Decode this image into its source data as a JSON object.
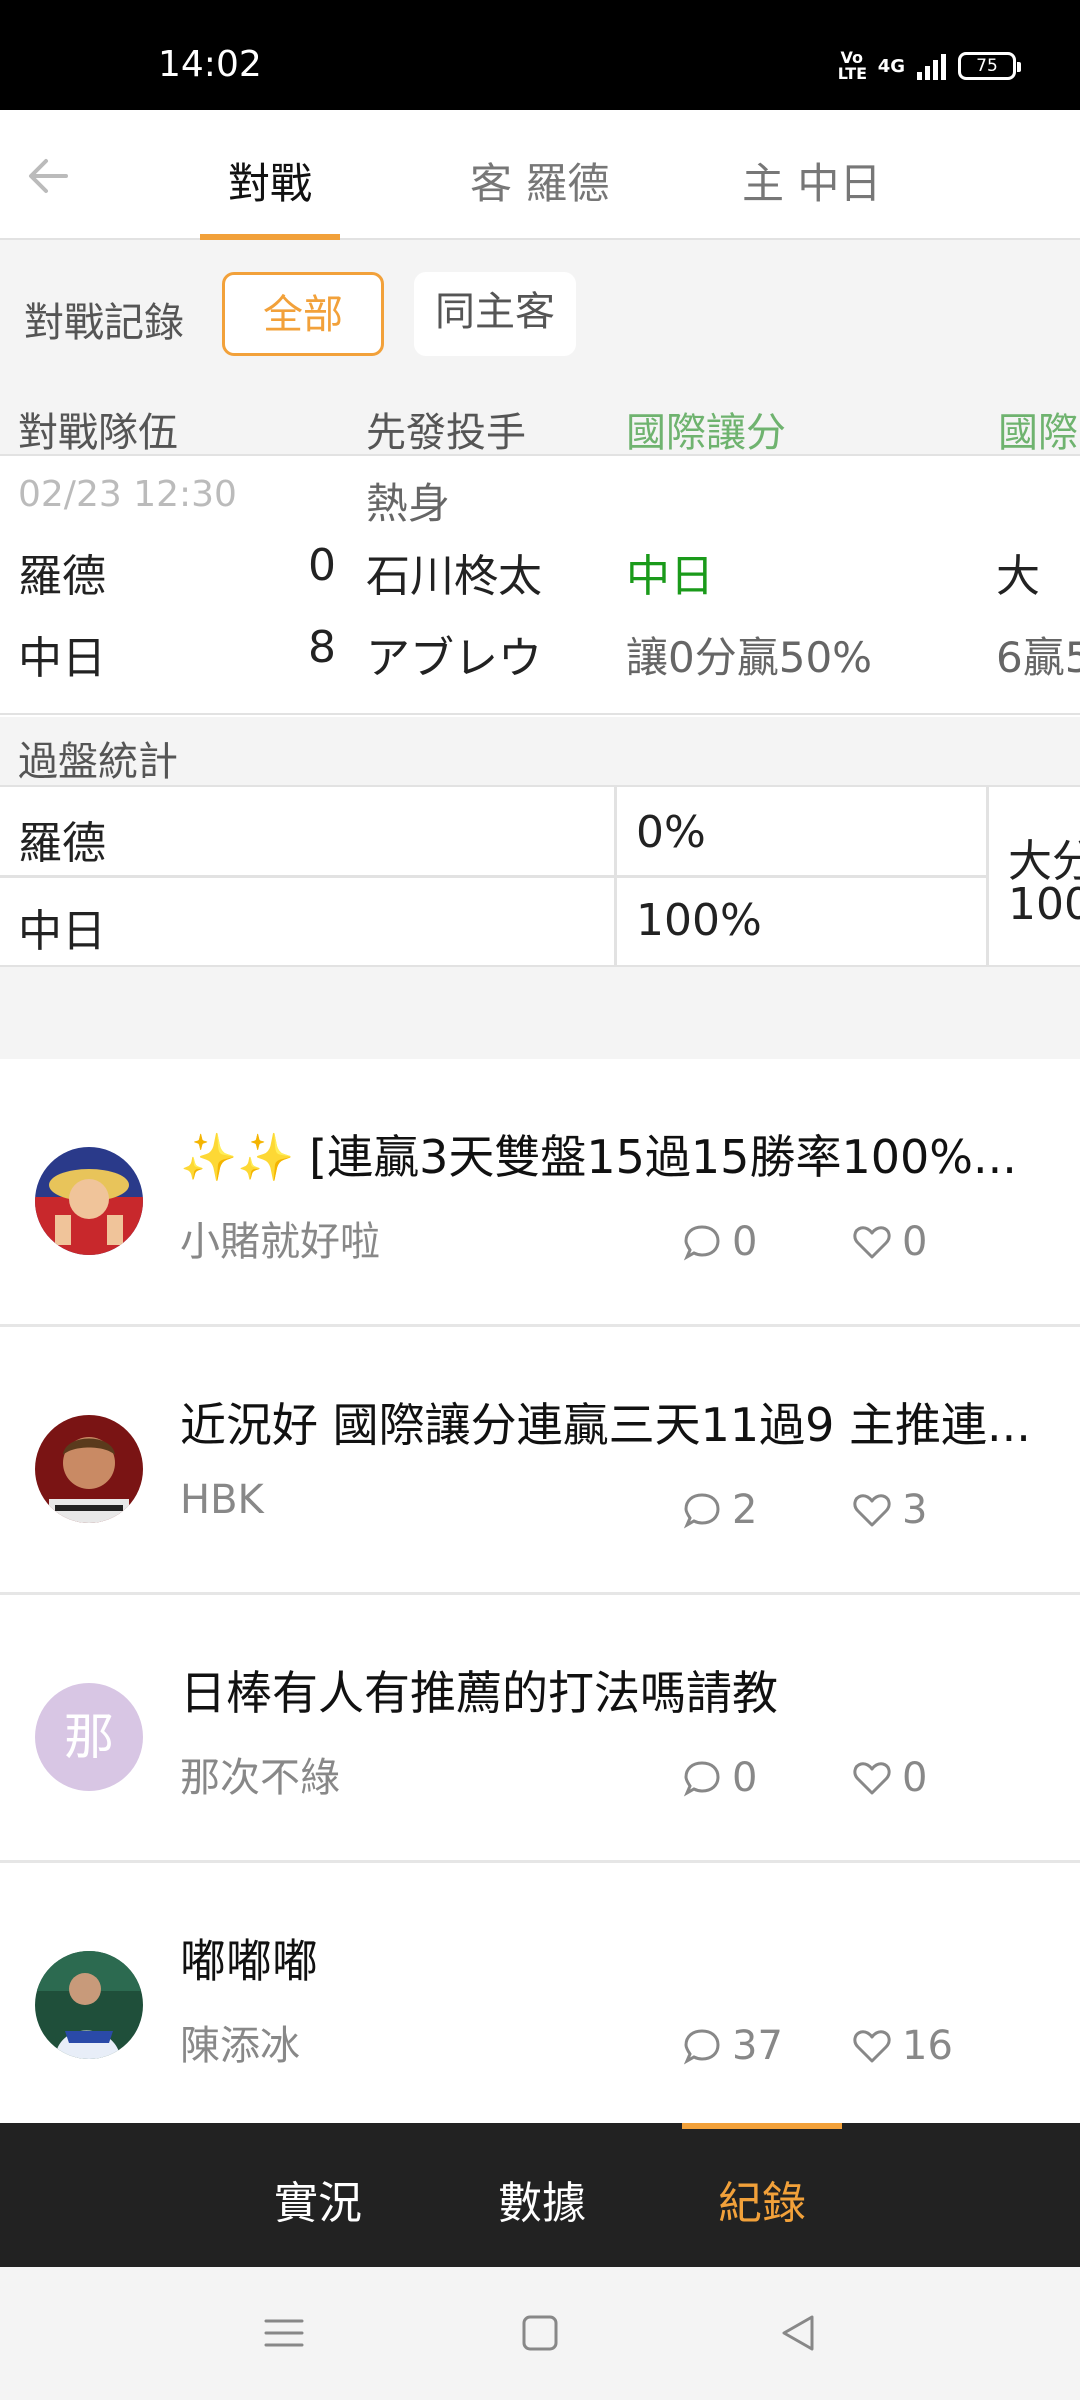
{
  "status_bar": {
    "time": "14:02",
    "volte": "Vo LTE",
    "network": "4G",
    "battery": "75"
  },
  "header": {
    "back_icon": "arrow-left-icon",
    "tabs": [
      {
        "label": "對戰",
        "active": true
      },
      {
        "label": "客 羅德",
        "active": false
      },
      {
        "label": "主 中日",
        "active": false
      }
    ],
    "accent_color": "#f2a13a"
  },
  "filter": {
    "label": "對戰記錄",
    "options": [
      {
        "label": "全部",
        "selected": true
      },
      {
        "label": "同主客",
        "selected": false
      }
    ]
  },
  "matchup": {
    "headers": [
      "對戰隊伍",
      "先發投手",
      "國際讓分",
      "國際"
    ],
    "date": "02/23 12:30",
    "status": "熱身",
    "rows": [
      {
        "team": "羅德",
        "score": "0",
        "pitcher": "石川柊太",
        "handicap": "中日",
        "ou": "大"
      },
      {
        "team": "中日",
        "score": "8",
        "pitcher": "アブレウ",
        "handicap": "讓0分贏50%",
        "ou": "6贏5"
      }
    ]
  },
  "stats": {
    "title": "過盤統計",
    "rows": [
      {
        "team": "羅德",
        "rate": "0%"
      },
      {
        "team": "中日",
        "rate": "100%"
      }
    ],
    "ou_label": "大分",
    "ou_value": "100"
  },
  "posts": [
    {
      "title": "✨✨ [連贏3天雙盤15過15勝率100%...",
      "author": "小賭就好啦",
      "comments": "0",
      "likes": "0",
      "avatar": "luffy-avatar"
    },
    {
      "title": "近況好 國際讓分連贏三天11過9 主推連...",
      "author": "HBK",
      "comments": "2",
      "likes": "3",
      "avatar": "wrestler-avatar"
    },
    {
      "title": "日棒有人有推薦的打法嗎請教",
      "author": "那次不綠",
      "comments": "0",
      "likes": "0",
      "avatar_letter": "那"
    },
    {
      "title": "嘟嘟嘟",
      "author": "陳添冰",
      "comments": "37",
      "likes": "16",
      "avatar": "baseball-player-avatar"
    }
  ],
  "bottom_tabs": [
    {
      "label": "實況",
      "active": false
    },
    {
      "label": "數據",
      "active": false
    },
    {
      "label": "紀錄",
      "active": true
    }
  ],
  "system_nav": [
    "menu-icon",
    "home-square-icon",
    "back-triangle-icon"
  ]
}
